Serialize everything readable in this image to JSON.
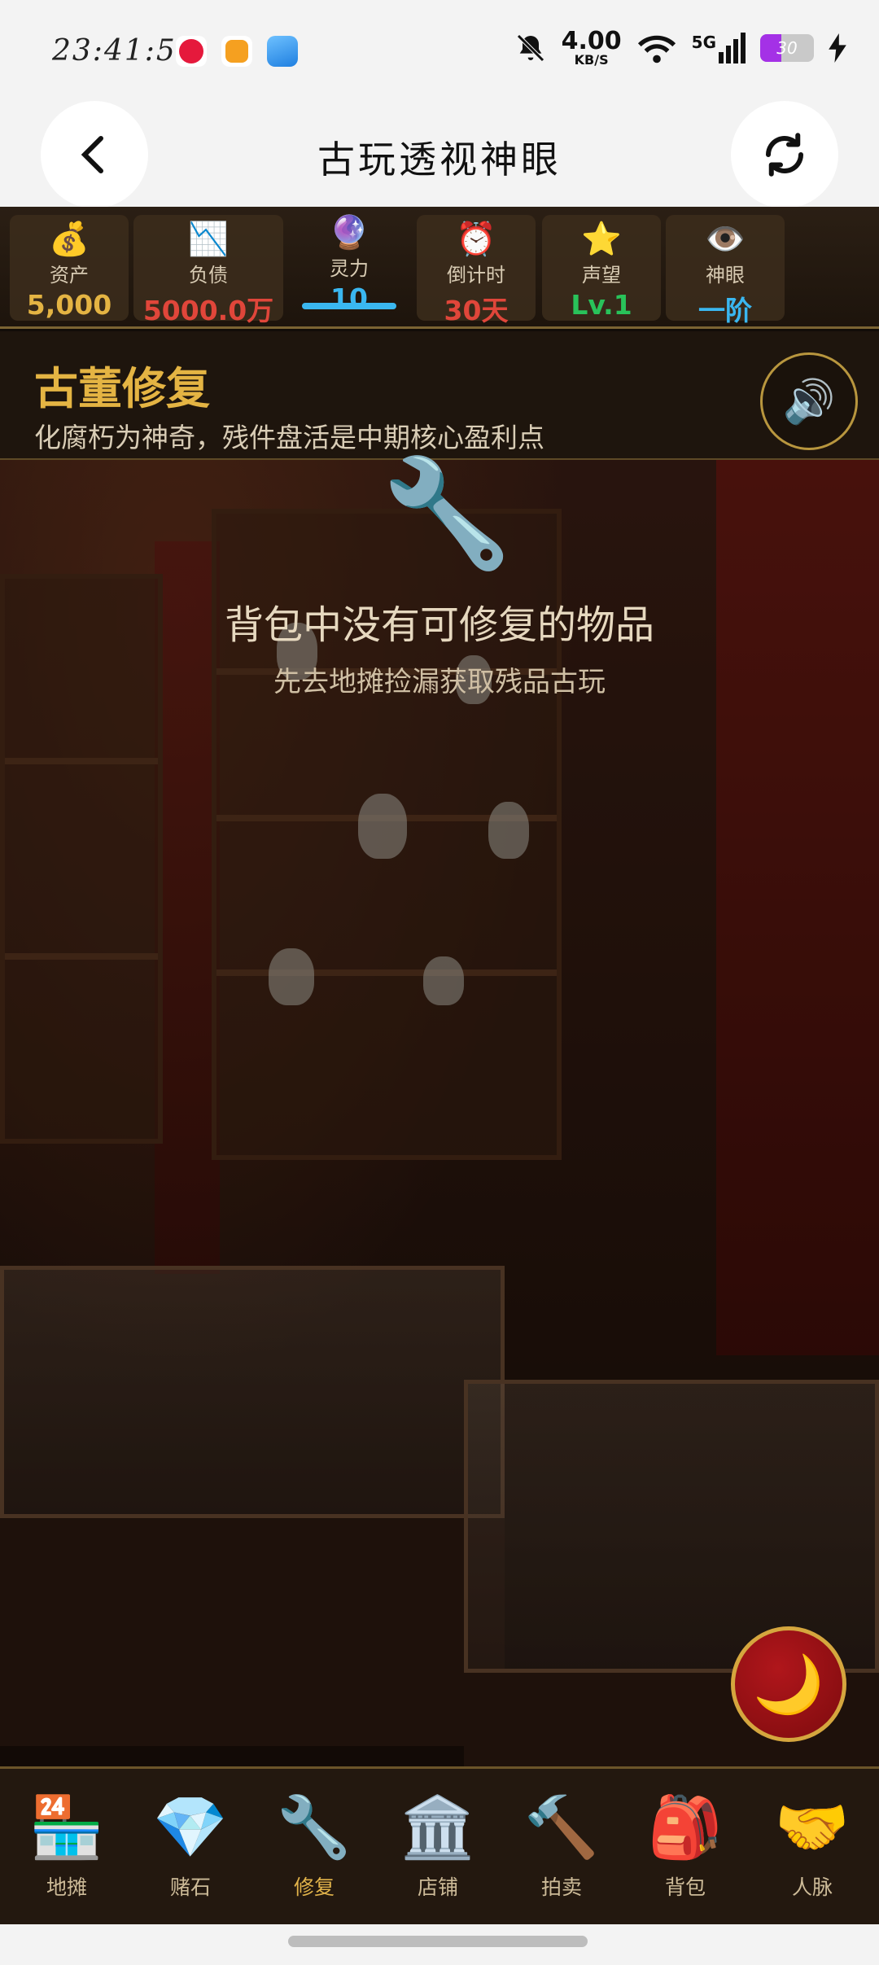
{
  "status_bar": {
    "time": "23:41:56",
    "net_speed_value": "4.00",
    "net_speed_unit": "KB/S",
    "network_type": "5G",
    "battery": "30",
    "icons": [
      "video-app-icon",
      "orange-app-icon",
      "gallery-app-icon",
      "mute-icon",
      "wifi-icon",
      "signal-icon",
      "battery-icon",
      "charging-icon"
    ]
  },
  "titlebar": {
    "title": "古玩透视神眼"
  },
  "stats": [
    {
      "emoji": "💰",
      "label": "资产",
      "value": "5,000",
      "color": "#e4b443"
    },
    {
      "emoji": "📉",
      "label": "负债",
      "value": "5000.0万",
      "color": "#e0463a"
    },
    {
      "emoji": "🔮",
      "label": "灵力",
      "value": "10",
      "color": "#3ab7f0"
    },
    {
      "emoji": "⏰",
      "label": "倒计时",
      "value": "30天",
      "color": "#e0463a"
    },
    {
      "emoji": "⭐",
      "label": "声望",
      "value": "Lv.1",
      "color": "#29c25a"
    },
    {
      "emoji": "👁️",
      "label": "神眼",
      "value": "一阶",
      "color": "#3ab7f0"
    }
  ],
  "section": {
    "title": "古董修复",
    "subtitle": "化腐朽为神奇，残件盘活是中期核心盈利点",
    "sound_icon": "🔊"
  },
  "empty_state": {
    "icon": "🔧",
    "title": "背包中没有可修复的物品",
    "subtitle": "先去地摊捡漏获取残品古玩"
  },
  "night_button_icon": "🌙",
  "nav": [
    {
      "icon": "🏪",
      "label": "地摊"
    },
    {
      "icon": "💎",
      "label": "赌石"
    },
    {
      "icon": "🔧",
      "label": "修复"
    },
    {
      "icon": "🏛️",
      "label": "店铺"
    },
    {
      "icon": "🔨",
      "label": "拍卖"
    },
    {
      "icon": "🎒",
      "label": "背包"
    },
    {
      "icon": "🤝",
      "label": "人脉"
    }
  ],
  "active_nav_index": 2,
  "active_stat_index": 2,
  "colors": {
    "gold": "#e4b443",
    "accent_blue": "#3ab7f0",
    "danger_red": "#e0463a",
    "green": "#29c25a"
  }
}
